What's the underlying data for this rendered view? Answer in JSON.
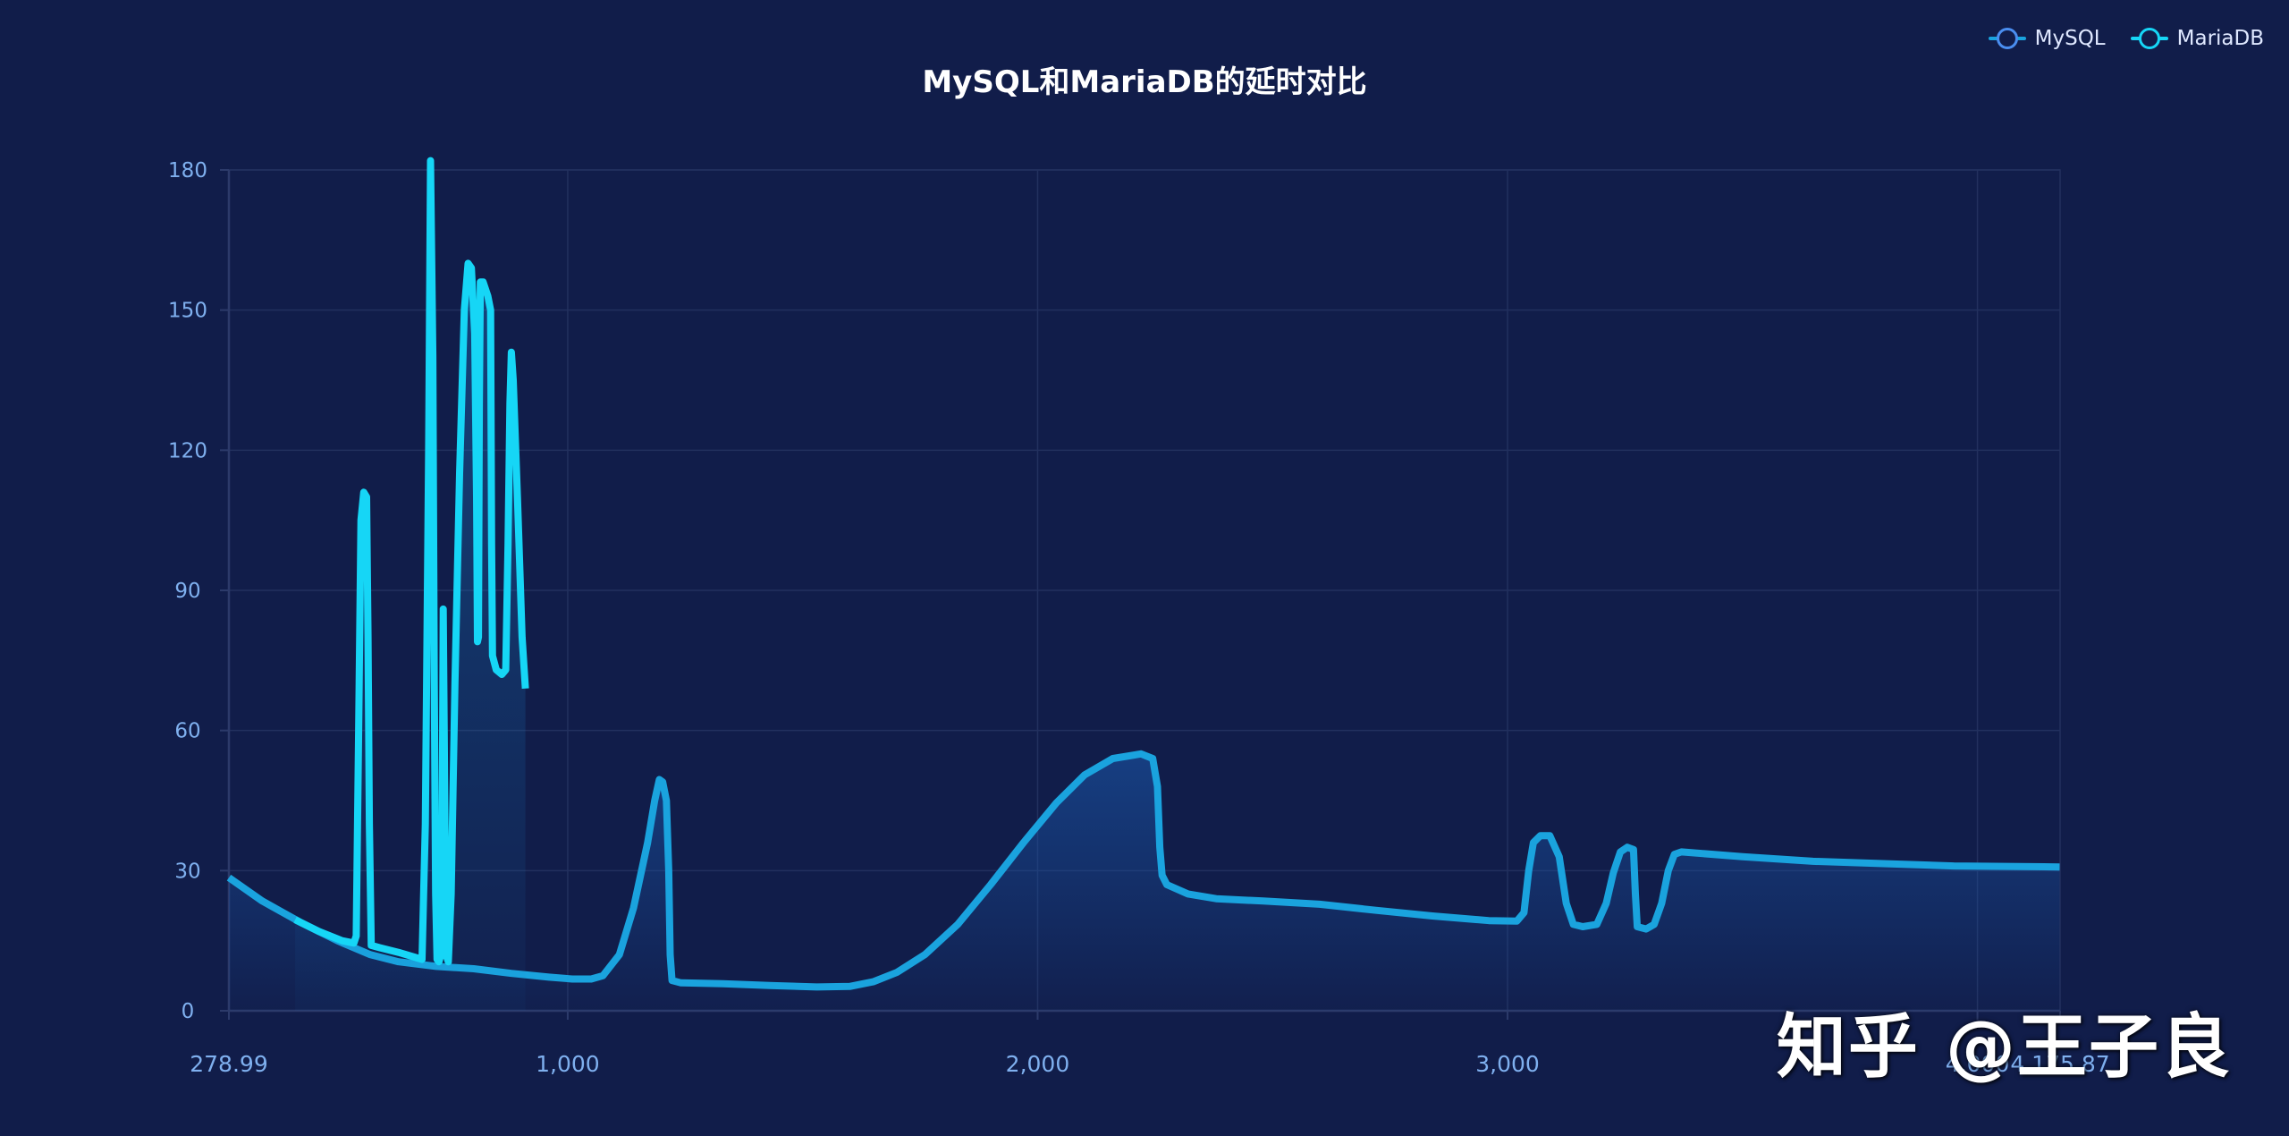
{
  "watermark": "知乎 @王子良",
  "colors": {
    "mysql": "#1aa3de",
    "mariadb": "#16d6f6",
    "grid": "#22305e",
    "axis": "#2c3a6a",
    "tick": "#7fb0ef"
  },
  "chart_data": {
    "type": "area",
    "title": "MySQL和MariaDB的延时对比",
    "xlabel": "",
    "ylabel": "",
    "legend": "top-right",
    "grid": true,
    "xlim": [
      278.99,
      4175.87
    ],
    "ylim": [
      0,
      180
    ],
    "x_ticks": [
      {
        "value": 278.99,
        "label": "278.99"
      },
      {
        "value": 1000,
        "label": "1,000"
      },
      {
        "value": 2000,
        "label": "2,000"
      },
      {
        "value": 3000,
        "label": "3,000"
      },
      {
        "value": 4000,
        "label": "4,000"
      },
      {
        "value": 4175.87,
        "label": "4,175.87"
      }
    ],
    "y_ticks": [
      0,
      30,
      60,
      90,
      120,
      150,
      180
    ],
    "series": [
      {
        "name": "MySQL",
        "color": "#1aa3de",
        "points": [
          [
            279,
            28.5
          ],
          [
            350,
            23.5
          ],
          [
            430,
            19
          ],
          [
            510,
            15
          ],
          [
            580,
            12
          ],
          [
            640,
            10.5
          ],
          [
            720,
            9.5
          ],
          [
            800,
            9
          ],
          [
            880,
            8
          ],
          [
            960,
            7.2
          ],
          [
            1010,
            6.8
          ],
          [
            1050,
            6.8
          ],
          [
            1075,
            7.5
          ],
          [
            1110,
            12
          ],
          [
            1140,
            22
          ],
          [
            1170,
            36
          ],
          [
            1185,
            45
          ],
          [
            1195,
            49.5
          ],
          [
            1202,
            49
          ],
          [
            1210,
            45
          ],
          [
            1215,
            30
          ],
          [
            1218,
            12
          ],
          [
            1222,
            6.5
          ],
          [
            1240,
            6
          ],
          [
            1330,
            5.8
          ],
          [
            1430,
            5.4
          ],
          [
            1530,
            5.1
          ],
          [
            1600,
            5.2
          ],
          [
            1650,
            6.2
          ],
          [
            1700,
            8.2
          ],
          [
            1760,
            12
          ],
          [
            1830,
            18.5
          ],
          [
            1900,
            27
          ],
          [
            1970,
            36
          ],
          [
            2040,
            44.5
          ],
          [
            2100,
            50.5
          ],
          [
            2160,
            54
          ],
          [
            2220,
            55
          ],
          [
            2245,
            54
          ],
          [
            2255,
            48
          ],
          [
            2260,
            35
          ],
          [
            2265,
            29
          ],
          [
            2275,
            27
          ],
          [
            2320,
            25
          ],
          [
            2380,
            24
          ],
          [
            2480,
            23.5
          ],
          [
            2600,
            22.8
          ],
          [
            2720,
            21.5
          ],
          [
            2840,
            20.3
          ],
          [
            2960,
            19.3
          ],
          [
            3020,
            19.2
          ],
          [
            3035,
            21
          ],
          [
            3045,
            30
          ],
          [
            3055,
            36
          ],
          [
            3070,
            37.5
          ],
          [
            3090,
            37.5
          ],
          [
            3110,
            33
          ],
          [
            3125,
            23
          ],
          [
            3140,
            18.5
          ],
          [
            3160,
            18
          ],
          [
            3190,
            18.5
          ],
          [
            3210,
            23
          ],
          [
            3225,
            29.5
          ],
          [
            3240,
            34
          ],
          [
            3255,
            35
          ],
          [
            3268,
            34.5
          ],
          [
            3272,
            25
          ],
          [
            3276,
            18
          ],
          [
            3295,
            17.5
          ],
          [
            3312,
            18.5
          ],
          [
            3328,
            23
          ],
          [
            3342,
            30
          ],
          [
            3355,
            33.5
          ],
          [
            3370,
            34
          ],
          [
            3500,
            33
          ],
          [
            3650,
            32
          ],
          [
            3800,
            31.5
          ],
          [
            3950,
            31
          ],
          [
            4175,
            30.8
          ]
        ]
      },
      {
        "name": "MariaDB",
        "color": "#16d6f6",
        "points": [
          [
            420,
            19.5
          ],
          [
            470,
            17
          ],
          [
            520,
            15
          ],
          [
            545,
            14.5
          ],
          [
            550,
            16
          ],
          [
            555,
            60
          ],
          [
            560,
            105
          ],
          [
            566,
            111
          ],
          [
            572,
            110
          ],
          [
            575,
            80
          ],
          [
            578,
            40
          ],
          [
            582,
            14
          ],
          [
            600,
            13.5
          ],
          [
            640,
            12.5
          ],
          [
            680,
            11.3
          ],
          [
            690,
            11
          ],
          [
            697,
            40
          ],
          [
            704,
            120
          ],
          [
            708,
            182
          ],
          [
            713,
            140
          ],
          [
            716,
            70
          ],
          [
            719,
            25
          ],
          [
            722,
            11
          ],
          [
            726,
            10.5
          ],
          [
            730,
            12
          ],
          [
            733,
            40
          ],
          [
            735,
            86
          ],
          [
            738,
            50
          ],
          [
            741,
            12
          ],
          [
            746,
            10.5
          ],
          [
            752,
            25
          ],
          [
            760,
            70
          ],
          [
            770,
            115
          ],
          [
            780,
            150
          ],
          [
            788,
            160
          ],
          [
            795,
            159
          ],
          [
            802,
            145
          ],
          [
            806,
            110
          ],
          [
            808,
            79
          ],
          [
            810,
            80
          ],
          [
            812,
            130
          ],
          [
            814,
            156
          ],
          [
            820,
            156
          ],
          [
            830,
            153
          ],
          [
            836,
            150
          ],
          [
            838,
            100
          ],
          [
            840,
            76
          ],
          [
            848,
            73
          ],
          [
            860,
            72
          ],
          [
            868,
            73
          ],
          [
            873,
            100
          ],
          [
            877,
            130
          ],
          [
            880,
            141
          ],
          [
            884,
            135
          ],
          [
            893,
            110
          ],
          [
            903,
            80
          ],
          [
            910,
            69
          ]
        ]
      }
    ]
  }
}
